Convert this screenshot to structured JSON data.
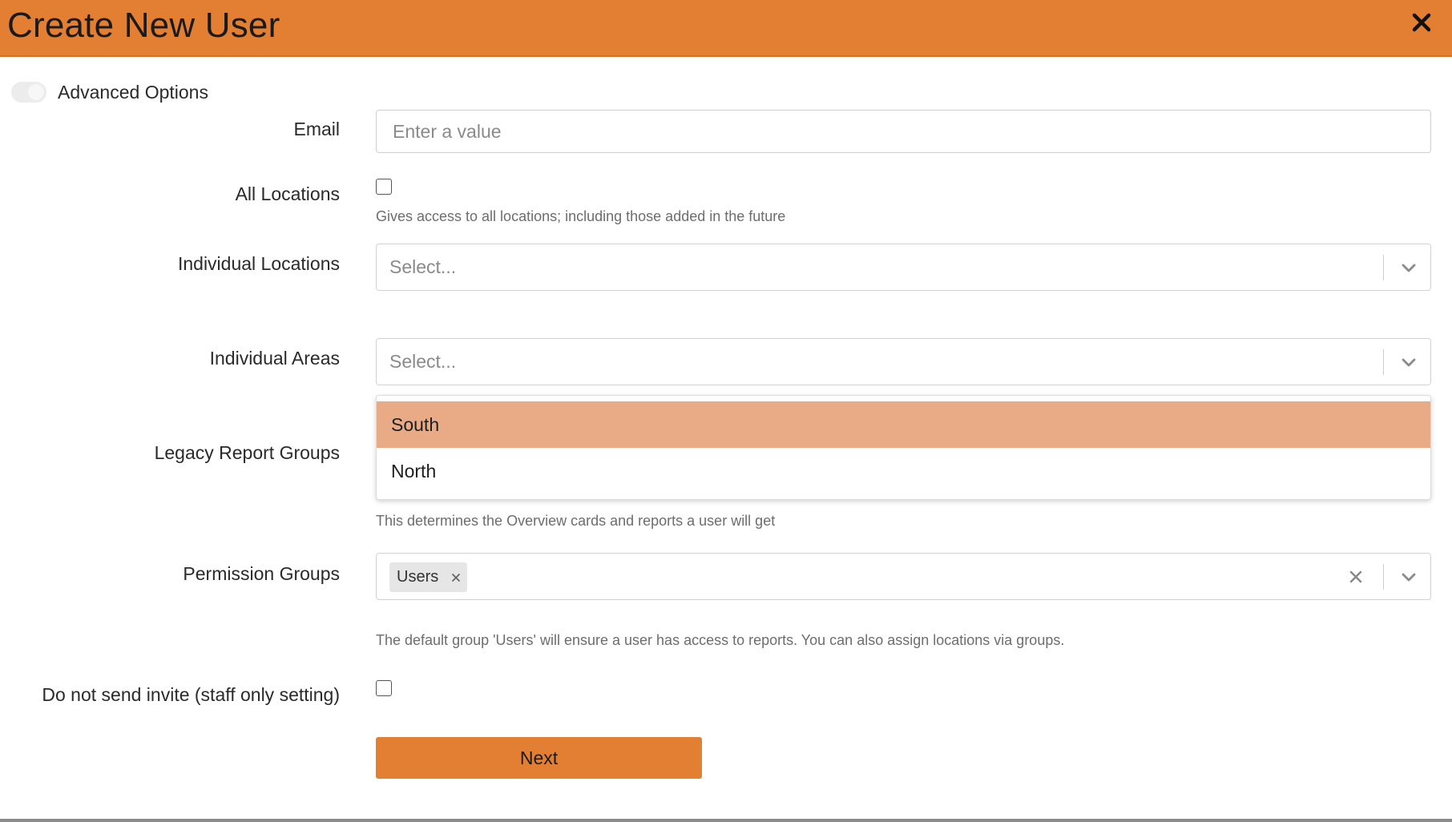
{
  "modal": {
    "title": "Create New User"
  },
  "advanced_options": {
    "label": "Advanced Options",
    "enabled": false
  },
  "form": {
    "email": {
      "label": "Email",
      "value": "",
      "placeholder": "Enter a value"
    },
    "all_locations": {
      "label": "All Locations",
      "checked": false,
      "help": "Gives access to all locations; including those added in the future"
    },
    "individual_locations": {
      "label": "Individual Locations",
      "placeholder": "Select..."
    },
    "individual_areas": {
      "label": "Individual Areas",
      "placeholder": "Select...",
      "menu_open": true,
      "options": [
        {
          "label": "South",
          "highlighted": true
        },
        {
          "label": "North",
          "highlighted": false
        }
      ]
    },
    "legacy_report_groups": {
      "label": "Legacy Report Groups",
      "help": "This determines the Overview cards and reports a user will get"
    },
    "permission_groups": {
      "label": "Permission Groups",
      "selected": [
        "Users"
      ],
      "help": "The default group 'Users' will ensure a user has access to reports. You can also assign locations via groups."
    },
    "do_not_send_invite": {
      "label": "Do not send invite (staff only setting)",
      "checked": false
    }
  },
  "actions": {
    "next_label": "Next"
  },
  "colors": {
    "header_bg": "#e27f33",
    "primary_button": "#e27f33",
    "option_highlight": "#e8ab86"
  },
  "icons": {
    "close": "close-icon",
    "dropdown": "chevron-down-icon",
    "clear": "clear-icon",
    "tag_remove": "tag-remove-icon"
  }
}
